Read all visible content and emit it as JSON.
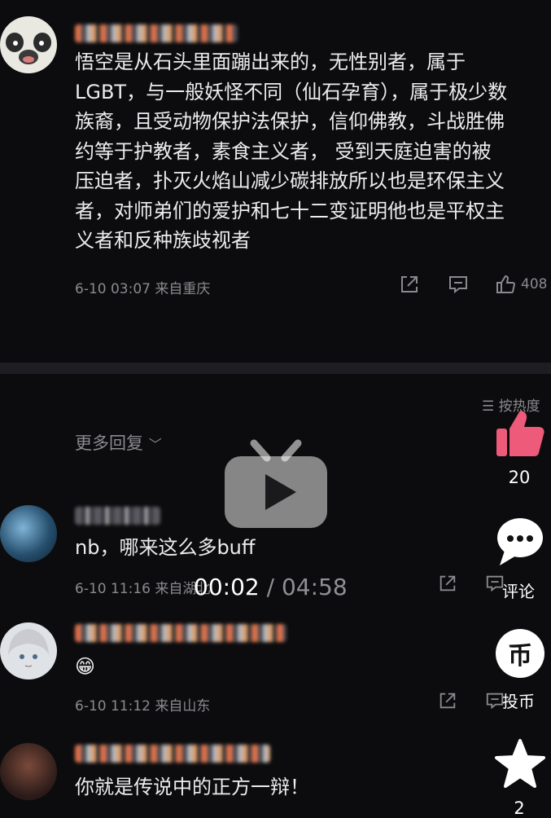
{
  "comments": [
    {
      "text": "悟空是从石头里面蹦出来的，无性别者，属于\nLGBT，与一般妖怪不同（仙石孕育），属于极少数\n族裔，且受动物保护法保护，信仰佛教，斗战胜佛\n约等于护教者，素食主义者， 受到天庭迫害的被\n压迫者，扑灭火焰山减少碳排放所以也是环保主义\n者，对师弟们的爱护和七十二变证明他也是平权主\n义者和反种族歧视者",
      "meta": "6-10 03:07 来自重庆",
      "likes": "408"
    },
    {
      "text": "nb，哪来这么多buff",
      "meta": "6-10 11:16 来自",
      "meta_hidden_suffix": "湖北"
    },
    {
      "text": "😁",
      "meta": "6-10 11:12 来自山东"
    },
    {
      "text": "你就是传说中的正方一辩！"
    }
  ],
  "sort_label": "按热度",
  "more_replies": "更多回复",
  "player": {
    "current": "00:02",
    "separator": "/",
    "total": "04:58"
  },
  "side": {
    "like_count": "20",
    "comment_label": "评论",
    "coin_label": "投币",
    "fav_count": "2",
    "coin_glyph": "币"
  },
  "colors": {
    "like_pink": "#ee5a7a",
    "background": "#0c0c0e"
  }
}
